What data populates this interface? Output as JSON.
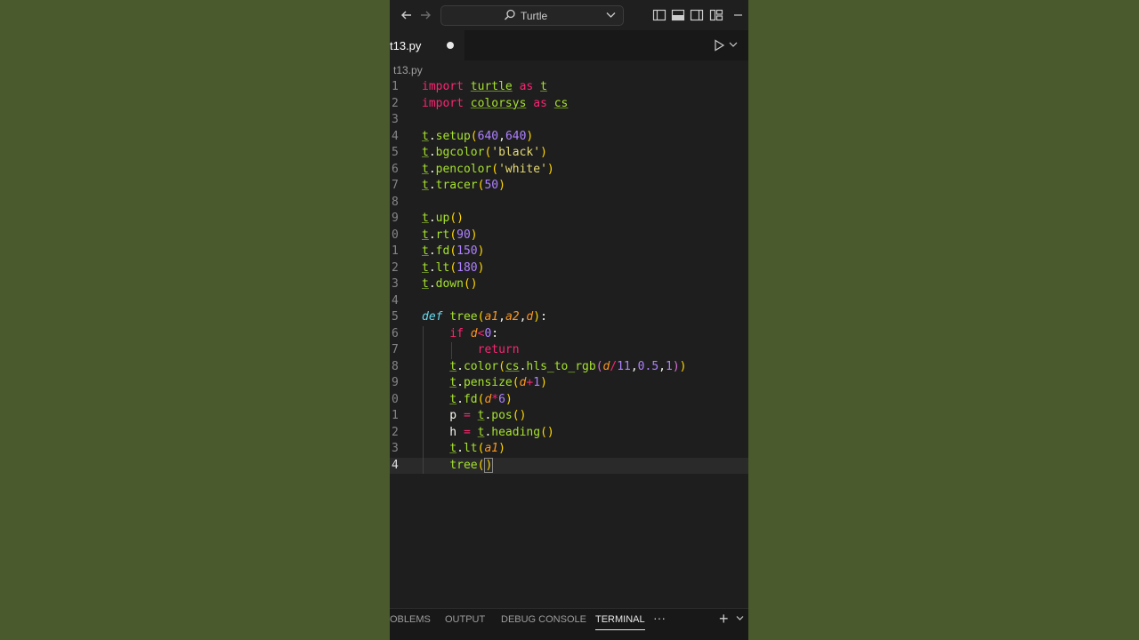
{
  "titlebar": {
    "search_label": "Turtle"
  },
  "tab": {
    "file_name": "t13.py",
    "modified": true
  },
  "breadcrumb": "t13.py",
  "colors": {
    "background": "#4a5a2c",
    "editor_bg": "#1e1e1e",
    "keyword": "#f92672",
    "function": "#a6e22e",
    "number": "#ae81ff",
    "string": "#e6db74"
  },
  "code": {
    "line_numbers": [
      "1",
      "2",
      "3",
      "4",
      "5",
      "6",
      "7",
      "8",
      "9",
      "0",
      "1",
      "2",
      "3",
      "4",
      "5",
      "6",
      "7",
      "8",
      "9",
      "0",
      "1",
      "2",
      "3",
      "4"
    ],
    "current_line_index": 23
  },
  "panel": {
    "tabs": [
      "OBLEMS",
      "OUTPUT",
      "DEBUG CONSOLE",
      "TERMINAL"
    ],
    "active_tab": "TERMINAL",
    "more": "···",
    "add": "+"
  }
}
